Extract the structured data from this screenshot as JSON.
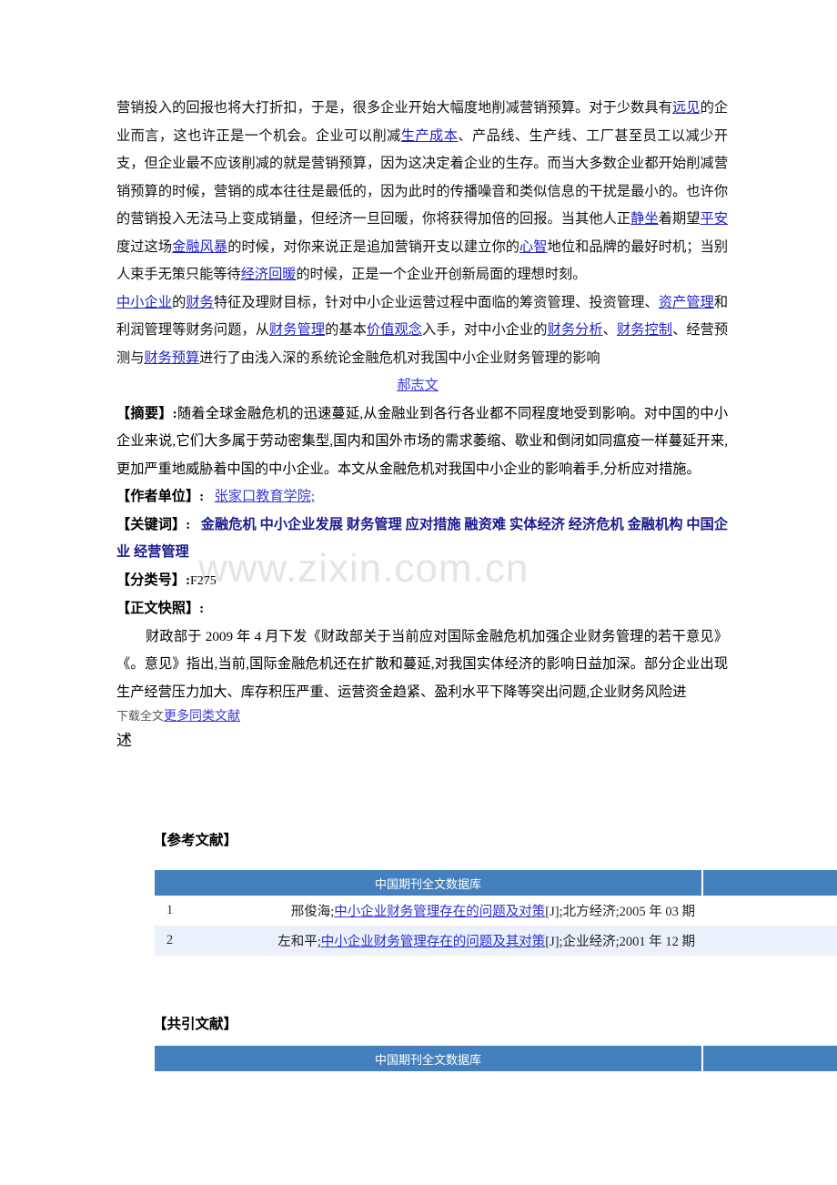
{
  "watermark": "www.zixin.com.cn",
  "document": {
    "paragraph1": {
      "seg1": "营销投入的回报也将大打折扣，于是，很多企业开始大幅度地削减营销预算。对于少数具有",
      "link1": "远见",
      "seg2": "的企业而言，这也许正是一个机会。企业可以削减",
      "link2": "生产成本",
      "seg3": "、产品线、生产线、工厂甚至员工以减少开支，但企业最不应该削减的就是营销预算，因为这决定着企业的生存。而当大多数企业都开始削减营销预算的时候，营销的成本往往是最低的，因为此时的传播噪音和类似信息的干扰是最小的。也许你的营销投入无法马上变成销量，但经济一旦回暖，你将获得加倍的回报。当其他人正",
      "link3": "静坐",
      "seg4": "着期望",
      "link4": "平安",
      "seg5": "度过这场",
      "link5": "金融风暴",
      "seg6": "的时候，对你来说正是追加营销开支以建立你的",
      "link6": "心智",
      "seg7": "地位和品牌的最好时机；当别人束手无策只能等待",
      "link7": "经济回暖",
      "seg8": "的时候，正是一个企业开创新局面的理想时刻。"
    },
    "paragraph2": {
      "link1": "中小企业",
      "seg1": "的",
      "link2": "财务",
      "seg2": "特征及理财目标，针对中小企业运营过程中面临的筹资管理、投资管理、",
      "link3": "资产管理",
      "seg3": "和利润管理等财务问题，从",
      "link4": "财务管理",
      "seg4": "的基本",
      "link5": "价值观念",
      "seg5": "入手，对中小企业的",
      "link6": "财务分析",
      "seg6": "、",
      "link7": "财务控制",
      "seg7": "、经营预测与",
      "link8": "财务预算",
      "seg8": "进行了由浅入深的系统论金融危机对我国中小企业财务管理的影响"
    },
    "author_link": "郝志文",
    "abstract": {
      "label": "【摘要】:",
      "text": "随着全球金融危机的迅速蔓延,从金融业到各行各业都不同程度地受到影响。对中国的中小企业来说,它们大多属于劳动密集型,国内和国外市场的需求萎缩、歇业和倒闭如同瘟疫一样蔓延开来,更加严重地威胁着中国的中小企业。本文从金融危机对我国中小企业的影响着手,分析应对措施。"
    },
    "affiliation": {
      "label": "【作者单位】:",
      "value": "张家口教育学院;"
    },
    "keywords": {
      "label": "【关键词】:",
      "value": "金融危机  中小企业发展  财务管理  应对措施  融资难  实体经济  经济危机  金融机构  中国企业  经营管理"
    },
    "classification": {
      "label": "【分类号】:",
      "value": "F275"
    },
    "fulltext": {
      "label": "【正文快照】:",
      "text": "财政部于 2009 年 4 月下发《财政部关于当前应对国际金融危机加强企业财务管理的若干意见》《。意见》指出,当前,国际金融危机还在扩散和蔓延,对我国实体经济的影响日益加深。部分企业出现生产经营压力加大、库存积压严重、运营资金趋紧、盈利水平下降等突出问题,企业财务风险进"
    },
    "download_text": "下载全文",
    "more_link": "更多同类文献",
    "tail_char": "述"
  },
  "references_section": {
    "heading": "【参考文献】",
    "table": {
      "header": "中国期刊全文数据库",
      "rows": [
        {
          "num": "1",
          "author": "邢俊海;",
          "title": "中小企业财务管理存在的问题及对策",
          "suffix": "[J];北方经济;2005 年 03 期"
        },
        {
          "num": "2",
          "author": "左和平;",
          "title": "中小企业财务管理存在的问题及其对策",
          "suffix": "[J];企业经济;2001 年 12 期"
        }
      ]
    }
  },
  "cocitations_section": {
    "heading": "【共引文献】",
    "table": {
      "header": "中国期刊全文数据库",
      "rows": []
    }
  },
  "colors": {
    "table_header_blue": "#4380bd",
    "row_alt_blue": "#eaf1fb",
    "link_blue": "#2222cc",
    "keyword_navy": "#1a1a8e",
    "watermark_gray": "#e4e4e4"
  }
}
